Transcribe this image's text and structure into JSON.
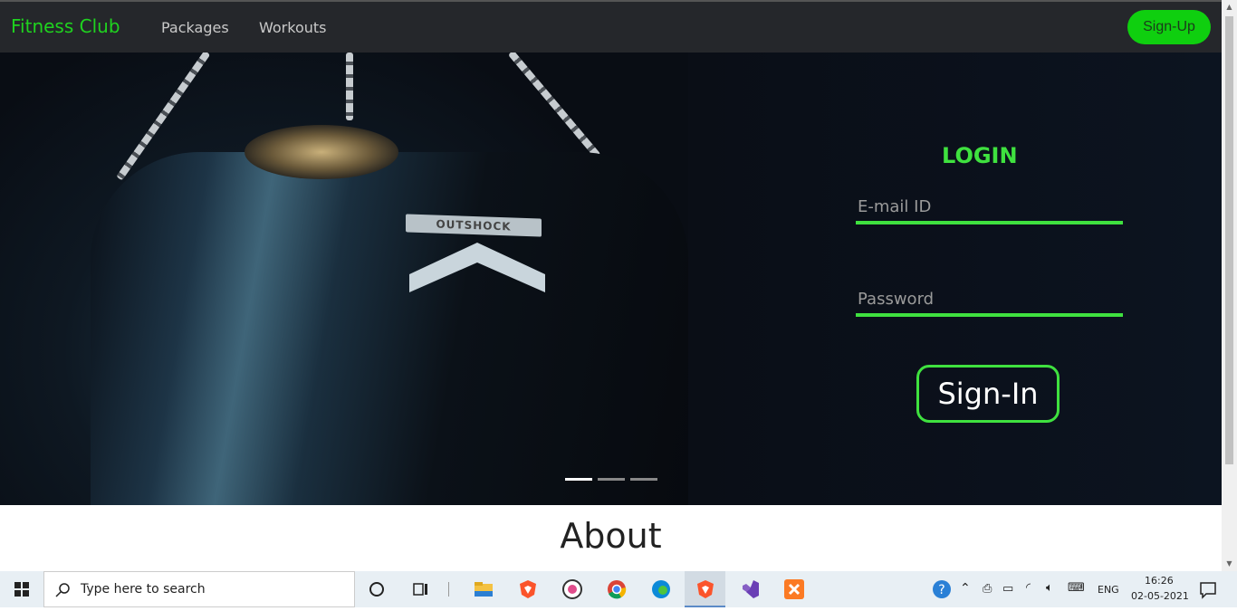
{
  "navbar": {
    "brand": "Fitness Club",
    "links": [
      "Packages",
      "Workouts"
    ],
    "signup_label": "Sign-Up"
  },
  "hero": {
    "bag_logo": "OUTSHOCK",
    "slide_count": 3,
    "active_slide": 1
  },
  "login": {
    "title": "LOGIN",
    "email_placeholder": "E-mail ID",
    "password_placeholder": "Password",
    "signin_label": "Sign-In"
  },
  "about": {
    "heading": "About"
  },
  "taskbar": {
    "search_placeholder": "Type here to search",
    "apps": [
      "cortana-icon",
      "task-view-icon",
      "file-explorer-icon",
      "brave-icon",
      "media-player-icon",
      "chrome-icon",
      "edge-icon",
      "brave-active-icon",
      "visual-studio-icon",
      "xampp-icon"
    ],
    "language": "ENG",
    "time": "16:26",
    "date": "02-05-2021"
  },
  "colors": {
    "accent": "#3fe13f",
    "brand_green": "#1fd31f",
    "navbar_bg": "#25272b"
  }
}
